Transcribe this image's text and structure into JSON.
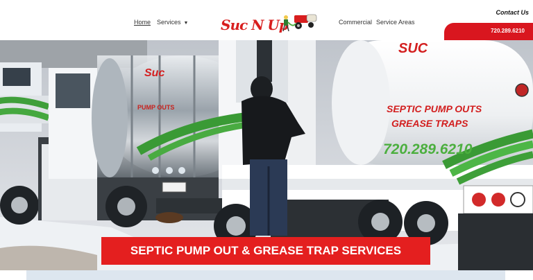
{
  "nav": {
    "home": "Home",
    "services": "Services",
    "services_caret": "▼",
    "commercial": "Commercial",
    "service_areas": "Service Areas"
  },
  "header": {
    "logo_text": "Suc N Up",
    "contact": "Contact Us",
    "phone": "720.289.6210"
  },
  "hero": {
    "tank_line1": "SEPTIC PUMP OUTS",
    "tank_line2": "GREASE TRAPS",
    "tank_phone": "720.289.6210",
    "banner": "SEPTIC PUMP OUT & GREASE TRAP SERVICES"
  },
  "colors": {
    "brand_red": "#e41f1f",
    "phone_tab": "#d9161f",
    "hose_green": "#4caf3f"
  },
  "icons": {
    "logo_mascot": "truck-mascot-icon"
  }
}
